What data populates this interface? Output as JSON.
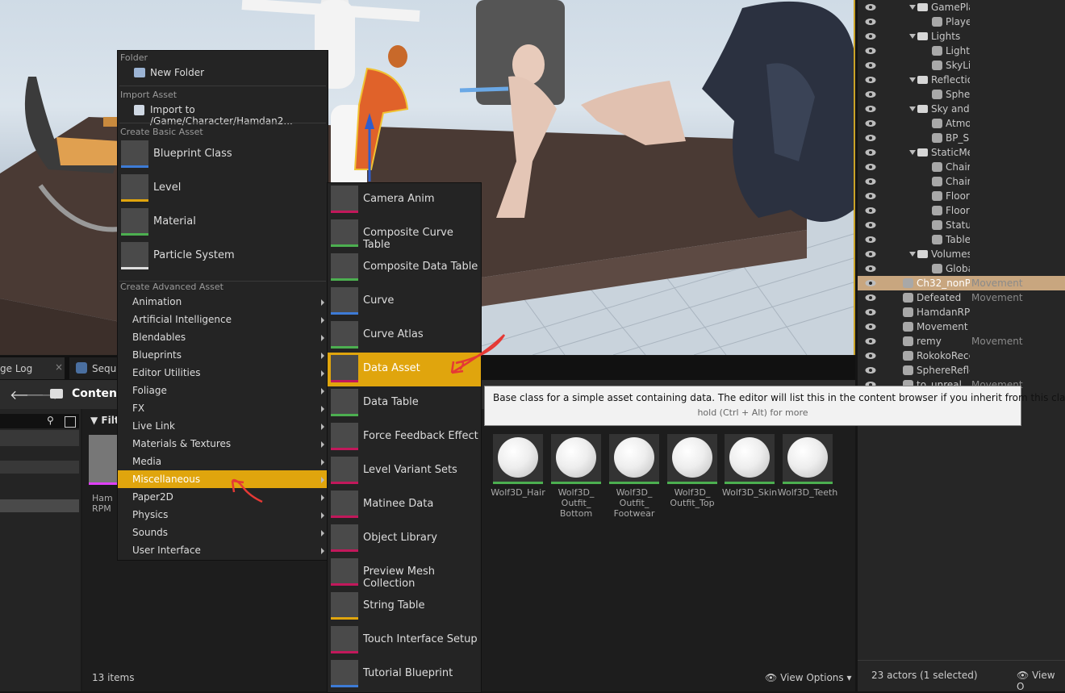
{
  "viewport": {},
  "outliner": {
    "rows": [
      {
        "name": "GamePlayA",
        "type": "",
        "indent": 1,
        "folder": true
      },
      {
        "name": "Player Sta",
        "type": "",
        "indent": 2,
        "folder": false
      },
      {
        "name": "Lights",
        "type": "",
        "indent": 1,
        "folder": true
      },
      {
        "name": "Light Sou",
        "type": "",
        "indent": 2,
        "folder": false
      },
      {
        "name": "SkyLight",
        "type": "",
        "indent": 2,
        "folder": false
      },
      {
        "name": "ReflectionCa",
        "type": "",
        "indent": 1,
        "folder": true
      },
      {
        "name": "SphereRe",
        "type": "",
        "indent": 2,
        "folder": false
      },
      {
        "name": "Sky and Fog",
        "type": "",
        "indent": 1,
        "folder": true
      },
      {
        "name": "Atmosphe",
        "type": "",
        "indent": 2,
        "folder": false
      },
      {
        "name": "BP_Sky_S",
        "type": "",
        "indent": 2,
        "folder": false
      },
      {
        "name": "StaticMeshe",
        "type": "",
        "indent": 1,
        "folder": true
      },
      {
        "name": "Chair",
        "type": "",
        "indent": 2,
        "folder": false
      },
      {
        "name": "Chair",
        "type": "",
        "indent": 2,
        "folder": false
      },
      {
        "name": "Floor",
        "type": "",
        "indent": 2,
        "folder": false
      },
      {
        "name": "Floor",
        "type": "",
        "indent": 2,
        "folder": false
      },
      {
        "name": "Statue",
        "type": "",
        "indent": 2,
        "folder": false
      },
      {
        "name": "Table",
        "type": "",
        "indent": 2,
        "folder": false
      },
      {
        "name": "Volumes",
        "type": "",
        "indent": 1,
        "folder": true
      },
      {
        "name": "GlobalPos",
        "type": "",
        "indent": 2,
        "folder": false
      },
      {
        "name": "Ch32_nonP",
        "type": "Movement",
        "indent": 0,
        "folder": false,
        "selected": true
      },
      {
        "name": "Defeated",
        "type": "Movement",
        "indent": 0,
        "folder": false
      },
      {
        "name": "HamdanRPI",
        "type": "",
        "indent": 0,
        "folder": false
      },
      {
        "name": "Movement",
        "type": "",
        "indent": 0,
        "folder": false
      },
      {
        "name": "remy",
        "type": "Movement",
        "indent": 0,
        "folder": false
      },
      {
        "name": "RokokoRece",
        "type": "",
        "indent": 0,
        "folder": false
      },
      {
        "name": "SphereRefle",
        "type": "",
        "indent": 0,
        "folder": false
      },
      {
        "name": "to_unreal",
        "type": "Movement",
        "indent": 0,
        "folder": false
      }
    ],
    "status": "23 actors (1 selected)",
    "view_options": "View O"
  },
  "tabs": {
    "message_log": "ge Log",
    "sequencer": "Seque"
  },
  "content_browser": {
    "title": "Content",
    "filters": "Filte",
    "item_count": "13 items",
    "view_options": "View Options",
    "assets": [
      {
        "label": "Wolf3D_Hair"
      },
      {
        "label": "Wolf3D_\nOutfit_\nBottom"
      },
      {
        "label": "Wolf3D_\nOutfit_\nFootwear"
      },
      {
        "label": "Wolf3D_\nOutfit_Top"
      },
      {
        "label": "Wolf3D_Skin"
      },
      {
        "label": "Wolf3D_Teeth"
      }
    ],
    "partial_asset_label": "Ham\nRPM",
    "partial_asset_label2": "e"
  },
  "context_menu": {
    "sections": {
      "folder": "Folder",
      "import": "Import Asset",
      "basic": "Create Basic Asset",
      "advanced": "Create Advanced Asset"
    },
    "new_folder": "New Folder",
    "import_to": "Import to /Game/Character/Hamdan2...",
    "basic_items": [
      {
        "label": "Blueprint Class",
        "color": "#3d7bd6"
      },
      {
        "label": "Level",
        "color": "#e0a50d"
      },
      {
        "label": "Material",
        "color": "#4caf50"
      },
      {
        "label": "Particle System",
        "color": "#dddddd"
      }
    ],
    "advanced_items": [
      {
        "label": "Animation"
      },
      {
        "label": "Artificial Intelligence"
      },
      {
        "label": "Blendables"
      },
      {
        "label": "Blueprints"
      },
      {
        "label": "Editor Utilities"
      },
      {
        "label": "Foliage"
      },
      {
        "label": "FX"
      },
      {
        "label": "Live Link"
      },
      {
        "label": "Materials & Textures"
      },
      {
        "label": "Media"
      },
      {
        "label": "Miscellaneous",
        "highlighted": true
      },
      {
        "label": "Paper2D"
      },
      {
        "label": "Physics"
      },
      {
        "label": "Sounds"
      },
      {
        "label": "User Interface"
      }
    ]
  },
  "submenu": {
    "items": [
      {
        "label": "Camera Anim",
        "color": "#c2185b"
      },
      {
        "label": "Composite Curve Table",
        "color": "#4caf50"
      },
      {
        "label": "Composite Data Table",
        "color": "#4caf50"
      },
      {
        "label": "Curve",
        "color": "#3d7bd6"
      },
      {
        "label": "Curve Atlas",
        "color": "#4caf50"
      },
      {
        "label": "Data Asset",
        "color": "#c2185b",
        "highlighted": true
      },
      {
        "label": "Data Table",
        "color": "#4caf50"
      },
      {
        "label": "Force Feedback Effect",
        "color": "#c2185b"
      },
      {
        "label": "Level Variant Sets",
        "color": "#c2185b"
      },
      {
        "label": "Matinee Data",
        "color": "#c2185b"
      },
      {
        "label": "Object Library",
        "color": "#c2185b"
      },
      {
        "label": "Preview Mesh Collection",
        "color": "#c2185b"
      },
      {
        "label": "String Table",
        "color": "#e0a50d"
      },
      {
        "label": "Touch Interface Setup",
        "color": "#c2185b"
      },
      {
        "label": "Tutorial Blueprint",
        "color": "#3d7bd6"
      }
    ]
  },
  "tooltip": {
    "text": "Base class for a simple asset containing data. The editor will list this in the content browser if you inherit from this class",
    "hint": "hold (Ctrl + Alt) for more"
  }
}
